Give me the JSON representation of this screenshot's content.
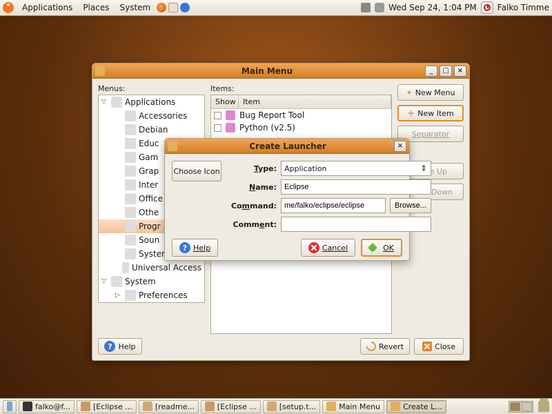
{
  "panel": {
    "menu_applications": "Applications",
    "menu_places": "Places",
    "menu_system": "System",
    "clock": "Wed Sep 24,  1:04 PM",
    "user": "Falko Timme"
  },
  "main_menu": {
    "title": "Main Menu",
    "menus_label": "Menus:",
    "items_label": "Items:",
    "tree": [
      {
        "label": "Applications",
        "depth": 0,
        "exp": "▽"
      },
      {
        "label": "Accessories",
        "depth": 1
      },
      {
        "label": "Debian",
        "depth": 1
      },
      {
        "label": "Educ",
        "depth": 1,
        "cut": true
      },
      {
        "label": "Gam",
        "depth": 1,
        "cut": true
      },
      {
        "label": "Grap",
        "depth": 1,
        "cut": true
      },
      {
        "label": "Inter",
        "depth": 1,
        "cut": true
      },
      {
        "label": "Office",
        "depth": 1,
        "cut": true
      },
      {
        "label": "Othe",
        "depth": 1,
        "cut": true
      },
      {
        "label": "Progr",
        "depth": 1,
        "sel": true,
        "cut": true
      },
      {
        "label": "Soun",
        "depth": 1,
        "cut": true
      },
      {
        "label": "System Tools",
        "depth": 1
      },
      {
        "label": "Universal Access",
        "depth": 1
      },
      {
        "label": "System",
        "depth": 0,
        "exp": "▽"
      },
      {
        "label": "Preferences",
        "depth": 1,
        "exp": "▷"
      }
    ],
    "items_header_show": "Show",
    "items_header_item": "Item",
    "items": [
      {
        "name": "Bug Report Tool"
      },
      {
        "name": "Python (v2.5)"
      }
    ],
    "btn_new_menu": "New Menu",
    "btn_new_item": "New Item",
    "btn_separator": "Separator",
    "btn_move_up": "Move Up",
    "btn_move_down": "Move Down",
    "btn_help": "Help",
    "btn_revert": "Revert",
    "btn_close": "Close"
  },
  "launcher": {
    "title": "Create Launcher",
    "choose_icon": "Choose Icon",
    "lbl_type": "Type:",
    "type_value": "Application",
    "lbl_name": "Name:",
    "name_value": "Eclipse",
    "lbl_command": "Command:",
    "command_value": "me/falko/eclipse/eclipse",
    "browse": "Browse...",
    "lbl_comment": "Comment:",
    "comment_value": "",
    "btn_help": "Help",
    "btn_cancel": "Cancel",
    "btn_ok": "OK"
  },
  "taskbar": {
    "items": [
      "falko@f...",
      "[Eclipse ...",
      "[readme...",
      "[Eclipse ...",
      "[setup.t...",
      "Main Menu",
      "Create L..."
    ],
    "active_index": 6
  }
}
